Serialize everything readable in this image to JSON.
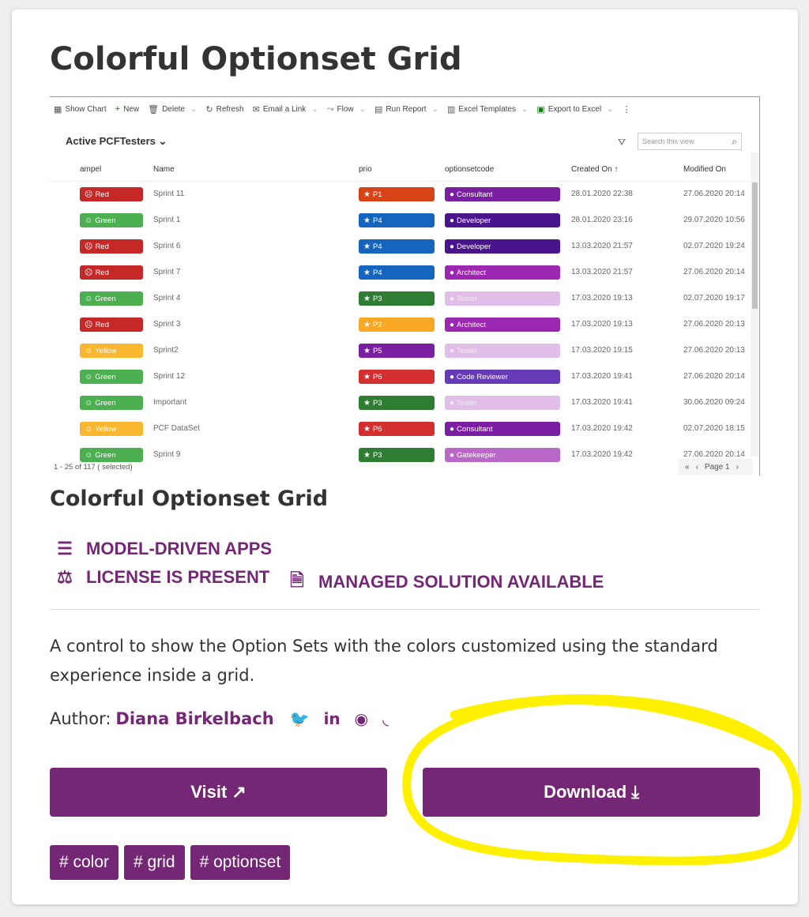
{
  "page": {
    "title": "Colorful Optionset Grid",
    "subtitle": "Colorful Optionset Grid"
  },
  "screenshot": {
    "toolbar": [
      {
        "icon": "chart-icon",
        "glyph": "▦",
        "label": "Show Chart",
        "menu": false
      },
      {
        "icon": "plus-icon",
        "glyph": "+",
        "label": "New",
        "menu": false
      },
      {
        "icon": "trash-icon",
        "glyph": "🗑",
        "label": "Delete",
        "menu": true
      },
      {
        "icon": "refresh-icon",
        "glyph": "↻",
        "label": "Refresh",
        "menu": false
      },
      {
        "icon": "mail-icon",
        "glyph": "✉",
        "label": "Email a Link",
        "menu": true
      },
      {
        "icon": "flow-icon",
        "glyph": "⤳",
        "label": "Flow",
        "menu": true
      },
      {
        "icon": "report-icon",
        "glyph": "▤",
        "label": "Run Report",
        "menu": true
      },
      {
        "icon": "excel-template-icon",
        "glyph": "▥",
        "label": "Excel Templates",
        "menu": true
      },
      {
        "icon": "excel-icon",
        "glyph": "▣",
        "label": "Export to Excel",
        "menu": true
      },
      {
        "icon": "more-icon",
        "glyph": "⋮",
        "label": "",
        "menu": false
      }
    ],
    "view_name": "Active PCFTesters",
    "search_placeholder": "Search this view",
    "columns": [
      "ampel",
      "Name",
      "prio",
      "optionsetcode",
      "Created On",
      "Modified On"
    ],
    "rows": [
      {
        "ampel": "Red",
        "name": "Sprint 11",
        "prio": "P1",
        "code": "Consultant",
        "created": "28.01.2020 22:38",
        "modified": "27.06.2020 20:14"
      },
      {
        "ampel": "Green",
        "name": "Sprint 1",
        "prio": "P4",
        "code": "Developer",
        "created": "28.01.2020 23:16",
        "modified": "29.07.2020 10:56"
      },
      {
        "ampel": "Red",
        "name": "Sprint 6",
        "prio": "P4",
        "code": "Developer",
        "created": "13.03.2020 21:57",
        "modified": "02.07.2020 19:24"
      },
      {
        "ampel": "Red",
        "name": "Sprint 7",
        "prio": "P4",
        "code": "Architect",
        "created": "13.03.2020 21:57",
        "modified": "27.06.2020 20:14"
      },
      {
        "ampel": "Green",
        "name": "Sprint 4",
        "prio": "P3",
        "code": "Tester",
        "created": "17.03.2020 19:13",
        "modified": "02.07.2020 19:17"
      },
      {
        "ampel": "Red",
        "name": "Sprint 3",
        "prio": "P2",
        "code": "Architect",
        "created": "17.03.2020 19:13",
        "modified": "27.06.2020 20:13"
      },
      {
        "ampel": "Yellow",
        "name": "Sprint2",
        "prio": "P5",
        "code": "Tester",
        "created": "17.03.2020 19:15",
        "modified": "27.06.2020 20:13"
      },
      {
        "ampel": "Green",
        "name": "Sprint 12",
        "prio": "P6",
        "code": "Code Reviewer",
        "created": "17.03.2020 19:41",
        "modified": "27.06.2020 20:14"
      },
      {
        "ampel": "Green",
        "name": "Important",
        "prio": "P3",
        "code": "Tester",
        "created": "17.03.2020 19:41",
        "modified": "30.06.2020 09:24"
      },
      {
        "ampel": "Yellow",
        "name": "PCF DataSet",
        "prio": "P6",
        "code": "Consultant",
        "created": "17.03.2020 19:42",
        "modified": "02.07.2020 18:15"
      },
      {
        "ampel": "Green",
        "name": "Sprint 9",
        "prio": "P3",
        "code": "Gatekeeper",
        "created": "17.03.2020 19:42",
        "modified": "27.06.2020 20:14"
      }
    ],
    "footer_count": "1 - 25 of 117 ( selected)",
    "page_label": "Page 1",
    "colors": {
      "ampel": {
        "Red": "#c62828",
        "Green": "#4caf50",
        "Yellow": "#f9b62f"
      },
      "prio": {
        "P1": "#d84315",
        "P2": "#f9a825",
        "P3": "#2e7d32",
        "P4": "#1565c0",
        "P5": "#7b1fa2",
        "P6": "#d32f2f"
      },
      "code": {
        "Consultant": "#7b1fa2",
        "Developer": "#4a148c",
        "Architect": "#9c27b0",
        "Tester": "#e1bee7",
        "Code Reviewer": "#673ab7",
        "Gatekeeper": "#ba68c8"
      }
    }
  },
  "features": [
    {
      "icon": "list-icon",
      "glyph": "☰",
      "label": "MODEL-DRIVEN APPS"
    },
    {
      "icon": "scale-icon",
      "glyph": "⚖",
      "label": "LICENSE IS PRESENT"
    },
    {
      "icon": "zip-file-icon",
      "glyph": "🗎",
      "label": "MANAGED SOLUTION AVAILABLE"
    }
  ],
  "description": "A control to show the Option Sets with the colors customized using the standard experience inside a grid.",
  "author": {
    "label": "Author:",
    "name": "Diana Birkelbach"
  },
  "buttons": {
    "visit": "Visit",
    "download": "Download"
  },
  "tags": [
    "# color",
    "# grid",
    "# optionset"
  ],
  "accent_color": "#742774"
}
